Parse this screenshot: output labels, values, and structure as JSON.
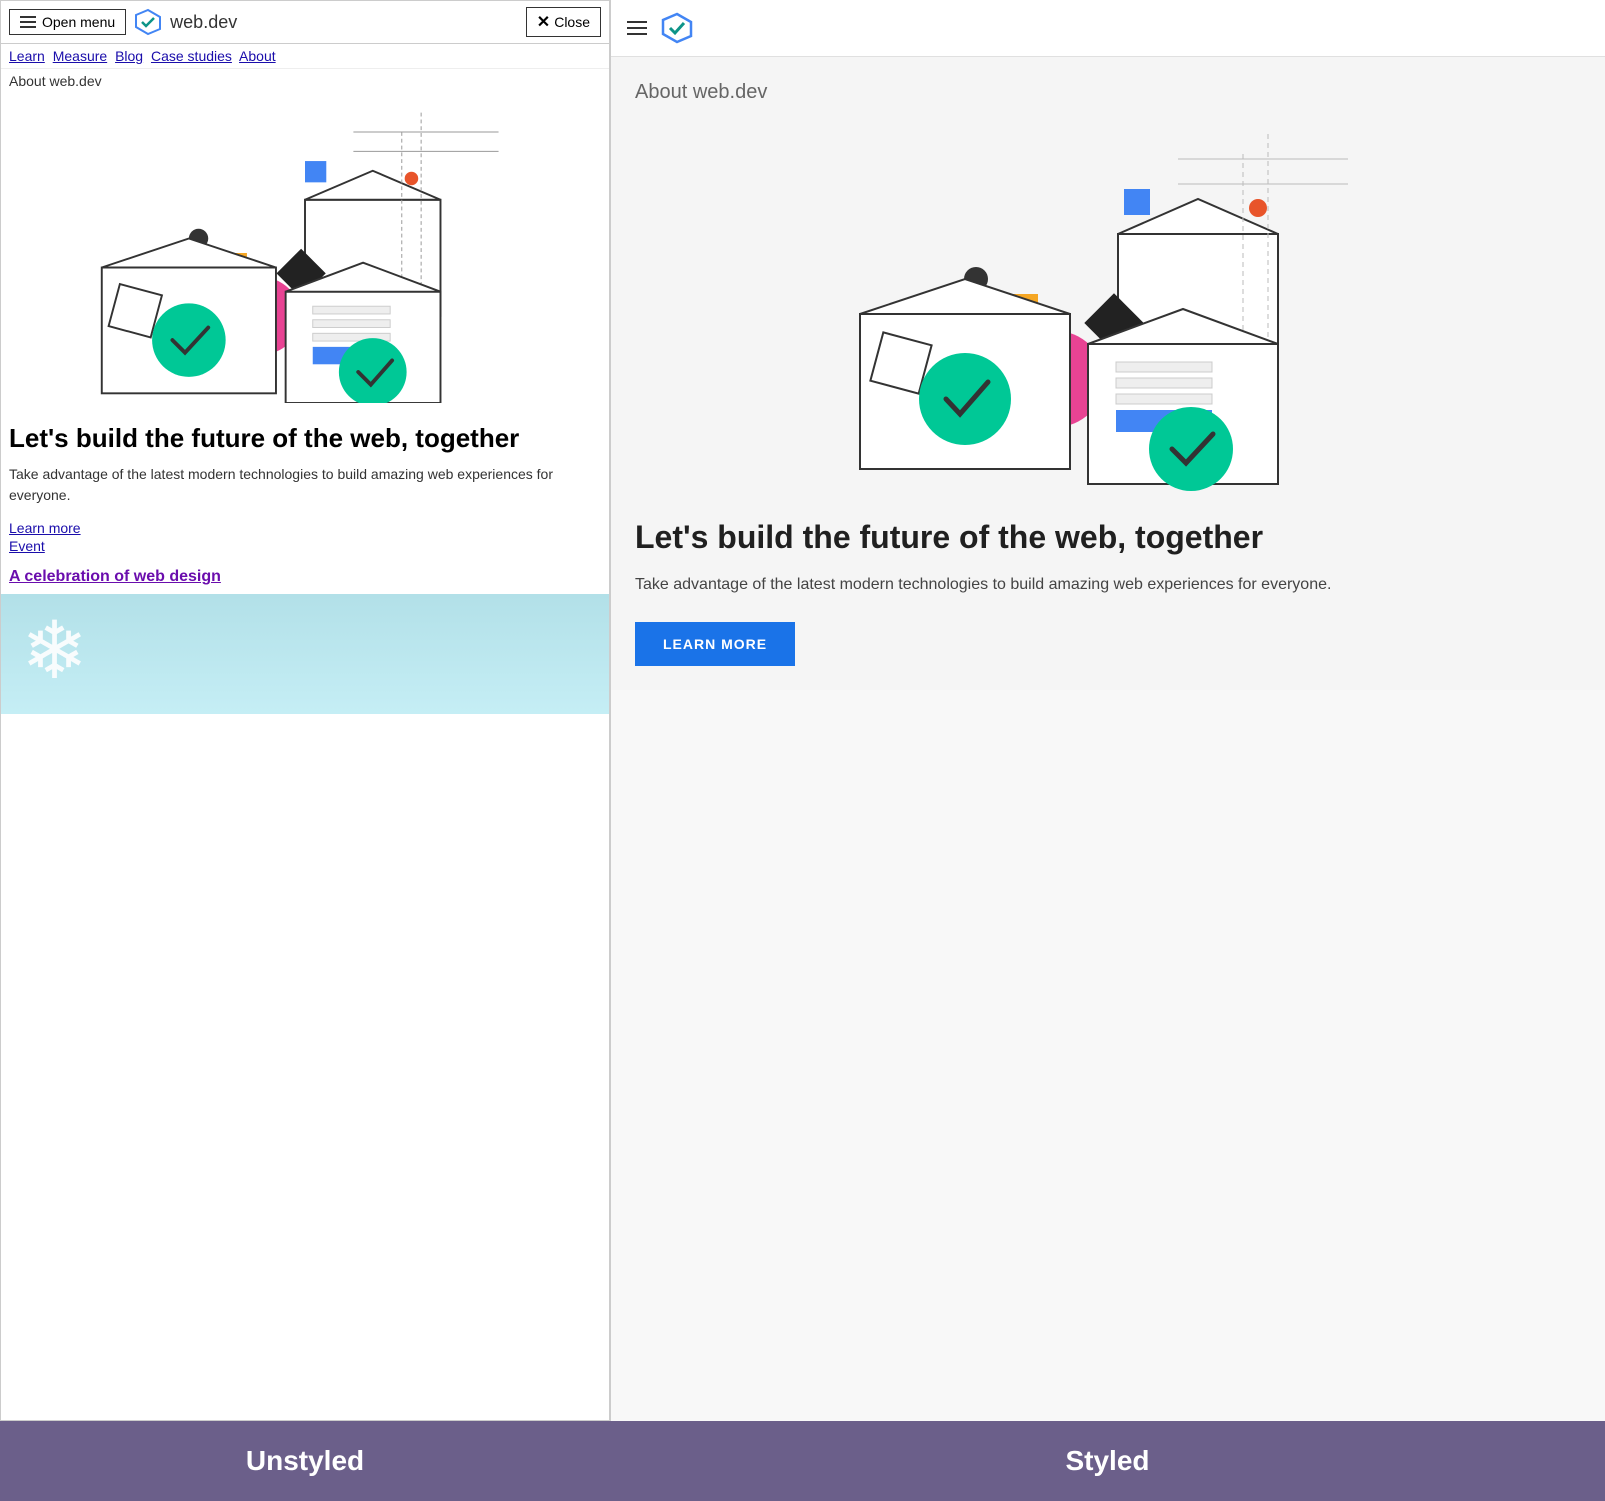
{
  "left_panel": {
    "menu_button": "Open menu",
    "site_name": "web.dev",
    "close_button": "Close",
    "nav_links": [
      "Learn",
      "Measure",
      "Blog",
      "Case studies",
      "About"
    ],
    "about_label": "About web.dev",
    "heading": "Let's build the future of the web, together",
    "body_text": "Take advantage of the latest modern technologies to build amazing web experiences for everyone.",
    "link1": "Learn more",
    "link2": "Event",
    "event_link": "A celebration of web design"
  },
  "right_panel": {
    "about_label": "About web.dev",
    "heading": "Let's build the future of the web, together",
    "body_text": "Take advantage of the latest modern technologies to build amazing web experiences for everyone.",
    "learn_more_btn": "LEARN MORE"
  },
  "bottom": {
    "unstyled_label": "Unstyled",
    "styled_label": "Styled"
  }
}
